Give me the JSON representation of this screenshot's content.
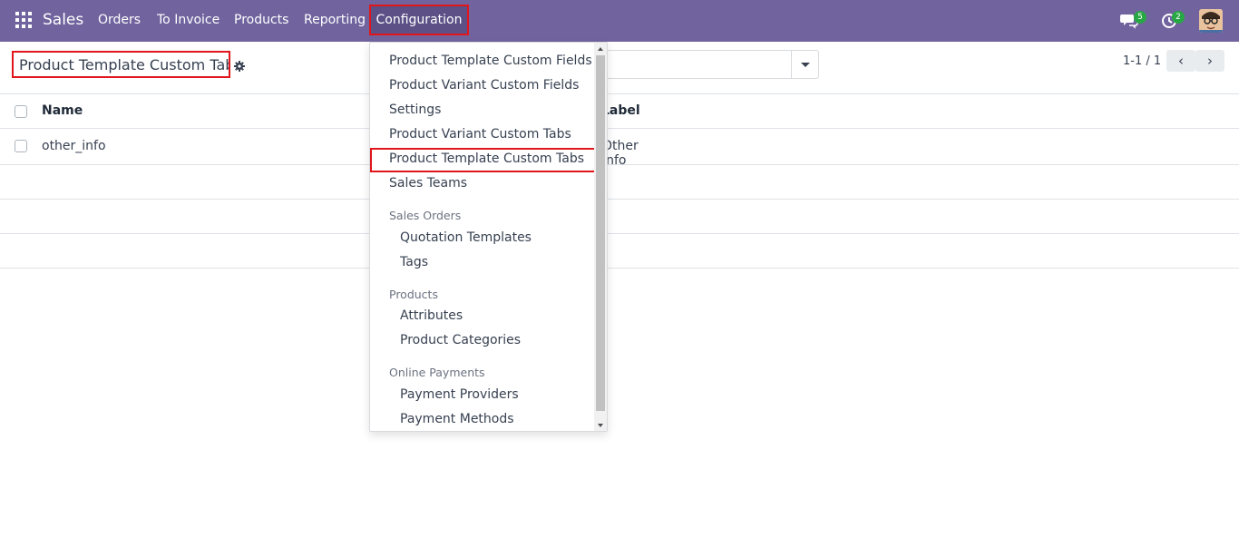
{
  "navbar": {
    "brand": "Sales",
    "menu": [
      "Orders",
      "To Invoice",
      "Products",
      "Reporting"
    ],
    "active_menu": "Configuration",
    "messages_count": "5",
    "activities_count": "2",
    "bg_color": "#71639e"
  },
  "control_panel": {
    "title": "Product Template Custom Tab",
    "pager_value": "1-1 / 1",
    "pager_prev": "‹",
    "pager_next": "›"
  },
  "list": {
    "columns": [
      "Name",
      "Label"
    ],
    "rows": [
      {
        "name": "other_info",
        "label": "Other Info"
      }
    ]
  },
  "config_menu": {
    "items": [
      "Product Template Custom Fields",
      "Product Variant Custom Fields",
      "Settings",
      "Product Variant Custom Tabs",
      "Product Template Custom Tabs",
      "Sales Teams"
    ],
    "sections": [
      {
        "header": "Sales Orders",
        "items": [
          "Quotation Templates",
          "Tags"
        ]
      },
      {
        "header": "Products",
        "items": [
          "Attributes",
          "Product Categories"
        ]
      },
      {
        "header": "Online Payments",
        "items": [
          "Payment Providers",
          "Payment Methods"
        ]
      }
    ],
    "highlighted": "Product Template Custom Tabs"
  }
}
